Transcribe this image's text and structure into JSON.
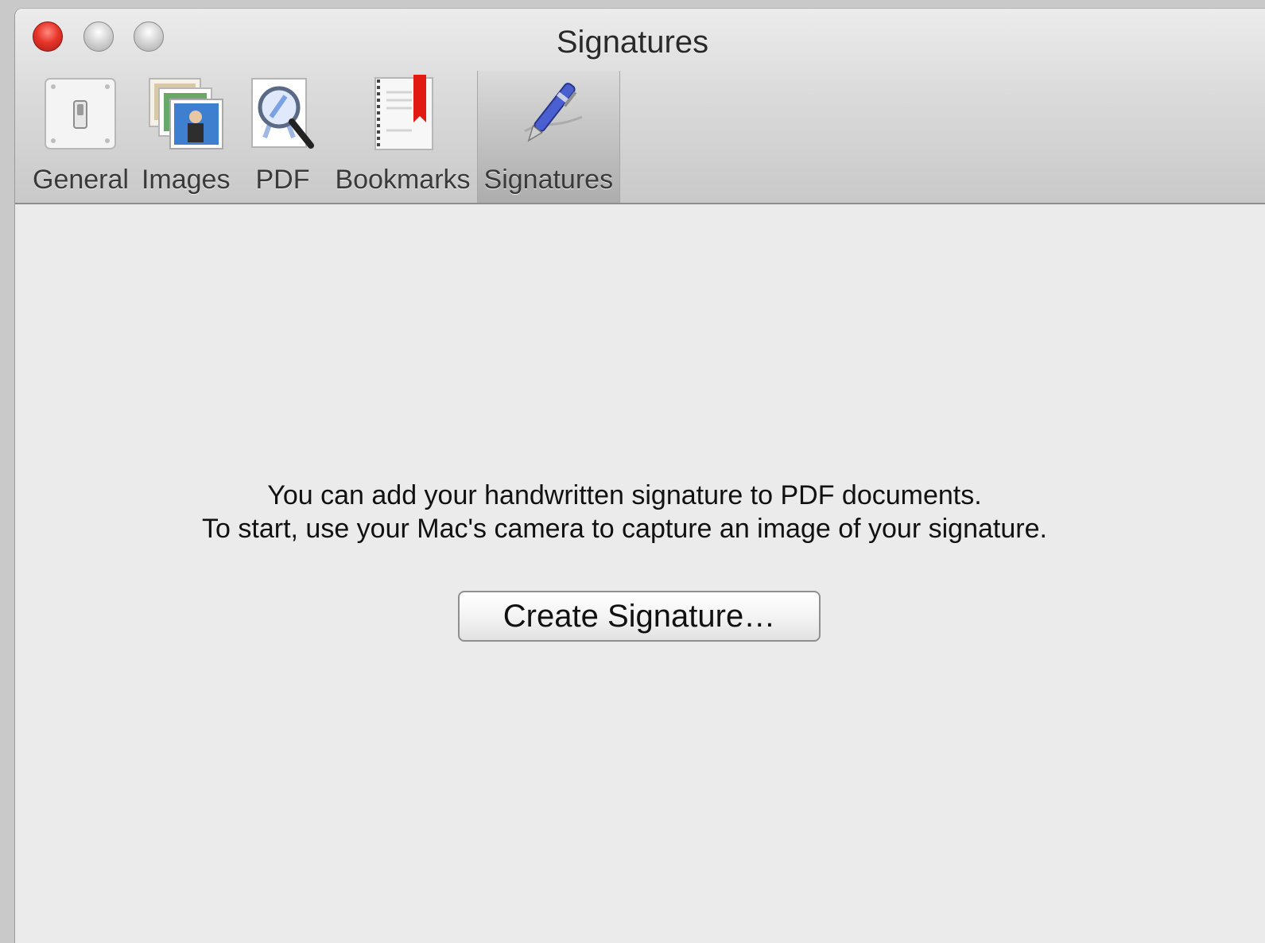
{
  "window": {
    "title": "Signatures"
  },
  "toolbar": {
    "items": [
      {
        "label": "General",
        "icon": "general-switch-icon",
        "selected": false
      },
      {
        "label": "Images",
        "icon": "images-stack-icon",
        "selected": false
      },
      {
        "label": "PDF",
        "icon": "pdf-magnifier-icon",
        "selected": false
      },
      {
        "label": "Bookmarks",
        "icon": "bookmark-book-icon",
        "selected": false
      },
      {
        "label": "Signatures",
        "icon": "pen-icon",
        "selected": true
      }
    ]
  },
  "content": {
    "message_line1": "You can add your handwritten signature to PDF documents.",
    "message_line2": "To start, use your Mac's camera to capture an image of your signature.",
    "create_button_label": "Create Signature…"
  },
  "colors": {
    "close": "#e8352b",
    "bookmark_ribbon": "#e11b14",
    "pen": "#4a5fd0"
  }
}
